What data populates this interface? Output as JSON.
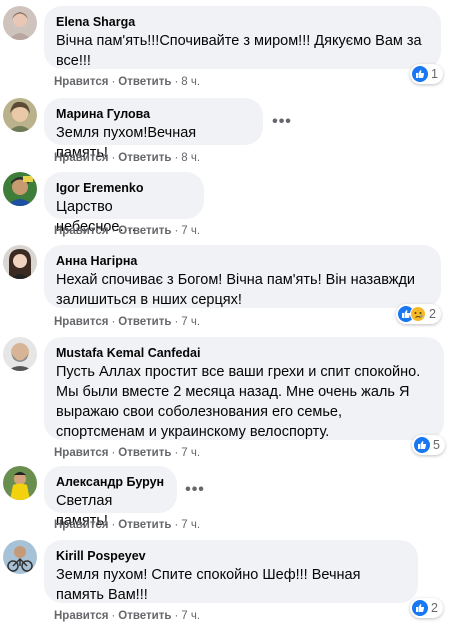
{
  "comments": [
    {
      "author": "Elena Sharga",
      "text": "Вічна пам'ять!!!Спочивайте з миром!!! Дякуємо Вам за все!!!",
      "like": "Нравится",
      "reply": "Ответить",
      "time": "8 ч.",
      "reactions": {
        "icons": [
          "like-icon"
        ],
        "count": "1"
      }
    },
    {
      "author": "Марина Гулова",
      "text": "Земля пухом!Вечная память!",
      "like": "Нравится",
      "reply": "Ответить",
      "time": "8 ч."
    },
    {
      "author": "Igor Eremenko",
      "text": "Царство небесное....",
      "like": "Нравится",
      "reply": "Ответить",
      "time": "7 ч."
    },
    {
      "author": "Анна Нагірна",
      "text": "Нехай спочиває з Богом! Вічна пам'ять! Він назавжди залишиться в нших серцях!",
      "like": "Нравится",
      "reply": "Ответить",
      "time": "7 ч.",
      "reactions": {
        "icons": [
          "like-icon",
          "sad-icon"
        ],
        "count": "2"
      }
    },
    {
      "author": "Mustafa Kemal Canfedai",
      "text": "Пусть Аллах простит все ваши грехи и спит спокойно. Мы были вместе 2 месяца назад. Мне очень жаль Я выражаю свои соболезнования его семье, спортсменам и украинскому велоспорту.",
      "like": "Нравится",
      "reply": "Ответить",
      "time": "7 ч.",
      "reactions": {
        "icons": [
          "like-icon"
        ],
        "count": "5"
      }
    },
    {
      "author": "Александр Бурун",
      "text": "Светлая память!",
      "like": "Нравится",
      "reply": "Ответить",
      "time": "7 ч."
    },
    {
      "author": "Kirill Pospeyev",
      "text": "Земля пухом! Спите спокойно Шеф!!! Вечная память Вам!!!",
      "like": "Нравится",
      "reply": "Ответить",
      "time": "7 ч.",
      "reactions": {
        "icons": [
          "like-icon"
        ],
        "count": "2"
      }
    }
  ],
  "more_icon": "•••",
  "dot": "·",
  "colors": {
    "bubble": "#f0f2f5",
    "like_blue": "#1877f2",
    "sad_yellow": "#f7b928",
    "meta_gray": "#65676b"
  }
}
